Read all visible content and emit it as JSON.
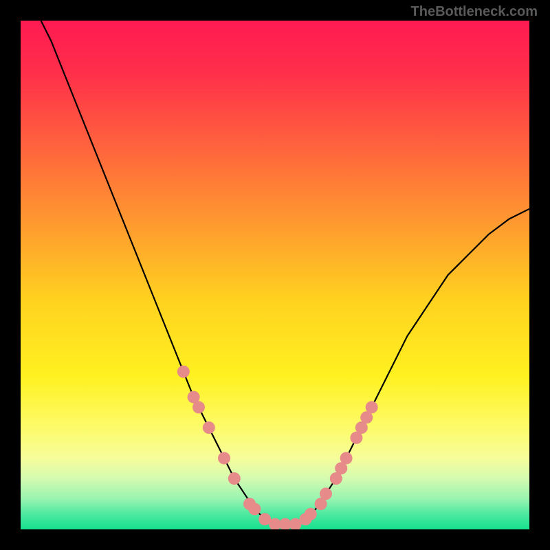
{
  "watermark": "TheBottleneck.com",
  "chart_data": {
    "type": "line",
    "title": "",
    "xlabel": "",
    "ylabel": "",
    "xlim": [
      0,
      100
    ],
    "ylim": [
      0,
      100
    ],
    "background_gradient": {
      "stops": [
        {
          "offset": 0.0,
          "color": "#ff1a52"
        },
        {
          "offset": 0.1,
          "color": "#ff2e4a"
        },
        {
          "offset": 0.25,
          "color": "#ff643d"
        },
        {
          "offset": 0.4,
          "color": "#ff9a2f"
        },
        {
          "offset": 0.55,
          "color": "#ffd21f"
        },
        {
          "offset": 0.7,
          "color": "#fff120"
        },
        {
          "offset": 0.8,
          "color": "#fdfb6a"
        },
        {
          "offset": 0.86,
          "color": "#f6fd9a"
        },
        {
          "offset": 0.9,
          "color": "#d4fbb0"
        },
        {
          "offset": 0.94,
          "color": "#99f4b0"
        },
        {
          "offset": 0.97,
          "color": "#4de9a0"
        },
        {
          "offset": 1.0,
          "color": "#16e08e"
        }
      ]
    },
    "series": [
      {
        "name": "bottleneck-curve",
        "color": "#000000",
        "x": [
          4,
          6,
          8,
          10,
          12,
          14,
          16,
          18,
          20,
          22,
          24,
          26,
          28,
          30,
          32,
          34,
          36,
          38,
          40,
          42,
          44,
          46,
          48,
          50,
          52,
          54,
          56,
          58,
          60,
          62,
          64,
          66,
          68,
          70,
          72,
          74,
          76,
          78,
          80,
          82,
          84,
          86,
          88,
          90,
          92,
          94,
          96,
          98,
          100
        ],
        "y": [
          100,
          96,
          91,
          86,
          81,
          76,
          71,
          66,
          61,
          56,
          51,
          46,
          41,
          36,
          31,
          26,
          22,
          18,
          14,
          10,
          7,
          4,
          2,
          1,
          0.5,
          1,
          2,
          4,
          7,
          10,
          14,
          18,
          22,
          26,
          30,
          34,
          38,
          41,
          44,
          47,
          50,
          52,
          54,
          56,
          58,
          59.5,
          61,
          62,
          63
        ]
      }
    ],
    "markers": {
      "name": "highlight-dots",
      "color": "#e68a8a",
      "radius": 9,
      "points": [
        {
          "x": 32,
          "y": 31
        },
        {
          "x": 34,
          "y": 26
        },
        {
          "x": 35,
          "y": 24
        },
        {
          "x": 37,
          "y": 20
        },
        {
          "x": 40,
          "y": 14
        },
        {
          "x": 42,
          "y": 10
        },
        {
          "x": 45,
          "y": 5
        },
        {
          "x": 46,
          "y": 4
        },
        {
          "x": 48,
          "y": 2
        },
        {
          "x": 50,
          "y": 1
        },
        {
          "x": 52,
          "y": 1
        },
        {
          "x": 54,
          "y": 1
        },
        {
          "x": 56,
          "y": 2
        },
        {
          "x": 57,
          "y": 3
        },
        {
          "x": 59,
          "y": 5
        },
        {
          "x": 60,
          "y": 7
        },
        {
          "x": 62,
          "y": 10
        },
        {
          "x": 63,
          "y": 12
        },
        {
          "x": 64,
          "y": 14
        },
        {
          "x": 66,
          "y": 18
        },
        {
          "x": 67,
          "y": 20
        },
        {
          "x": 68,
          "y": 22
        },
        {
          "x": 69,
          "y": 24
        }
      ]
    }
  }
}
